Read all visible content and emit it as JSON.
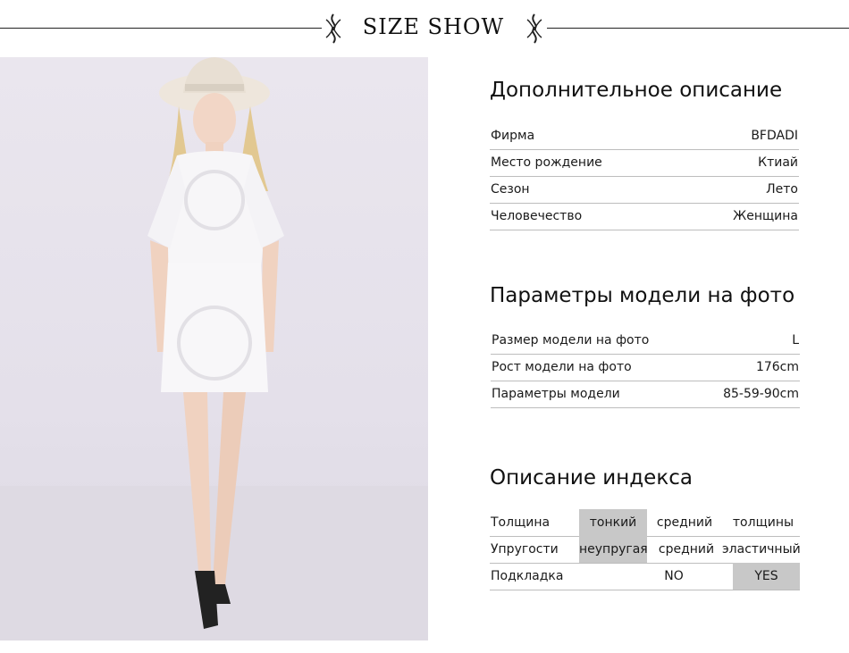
{
  "header": {
    "title": "SIZE SHOW"
  },
  "additional": {
    "title": "Дополнительное описание",
    "rows": [
      {
        "label": "Фирма",
        "value": "BFDADI"
      },
      {
        "label": "Место рождение",
        "value": "Ктиай"
      },
      {
        "label": "Сезон",
        "value": "Лето"
      },
      {
        "label": "Человечество",
        "value": "Женщина"
      }
    ]
  },
  "model": {
    "title": "Параметры модели на фото",
    "rows": [
      {
        "label": "Размер модели на фото",
        "value": "L"
      },
      {
        "label": "Рост модели на фото",
        "value": "176cm"
      },
      {
        "label": "Параметры модели",
        "value": "85-59-90cm"
      }
    ]
  },
  "index": {
    "title": "Описание индекса",
    "thickness": {
      "label": "Толщина",
      "opt1": "тонкий",
      "opt2": "средний",
      "opt3": "толщины",
      "selected": "тонкий"
    },
    "elasticity": {
      "label": "Упругости",
      "opt1": "неупругая",
      "opt2": "средний",
      "opt3": "эластичный",
      "selected": "неупругая"
    },
    "lining": {
      "label": "Подкладка",
      "no": "NO",
      "yes": "YES",
      "selected": "YES"
    }
  }
}
